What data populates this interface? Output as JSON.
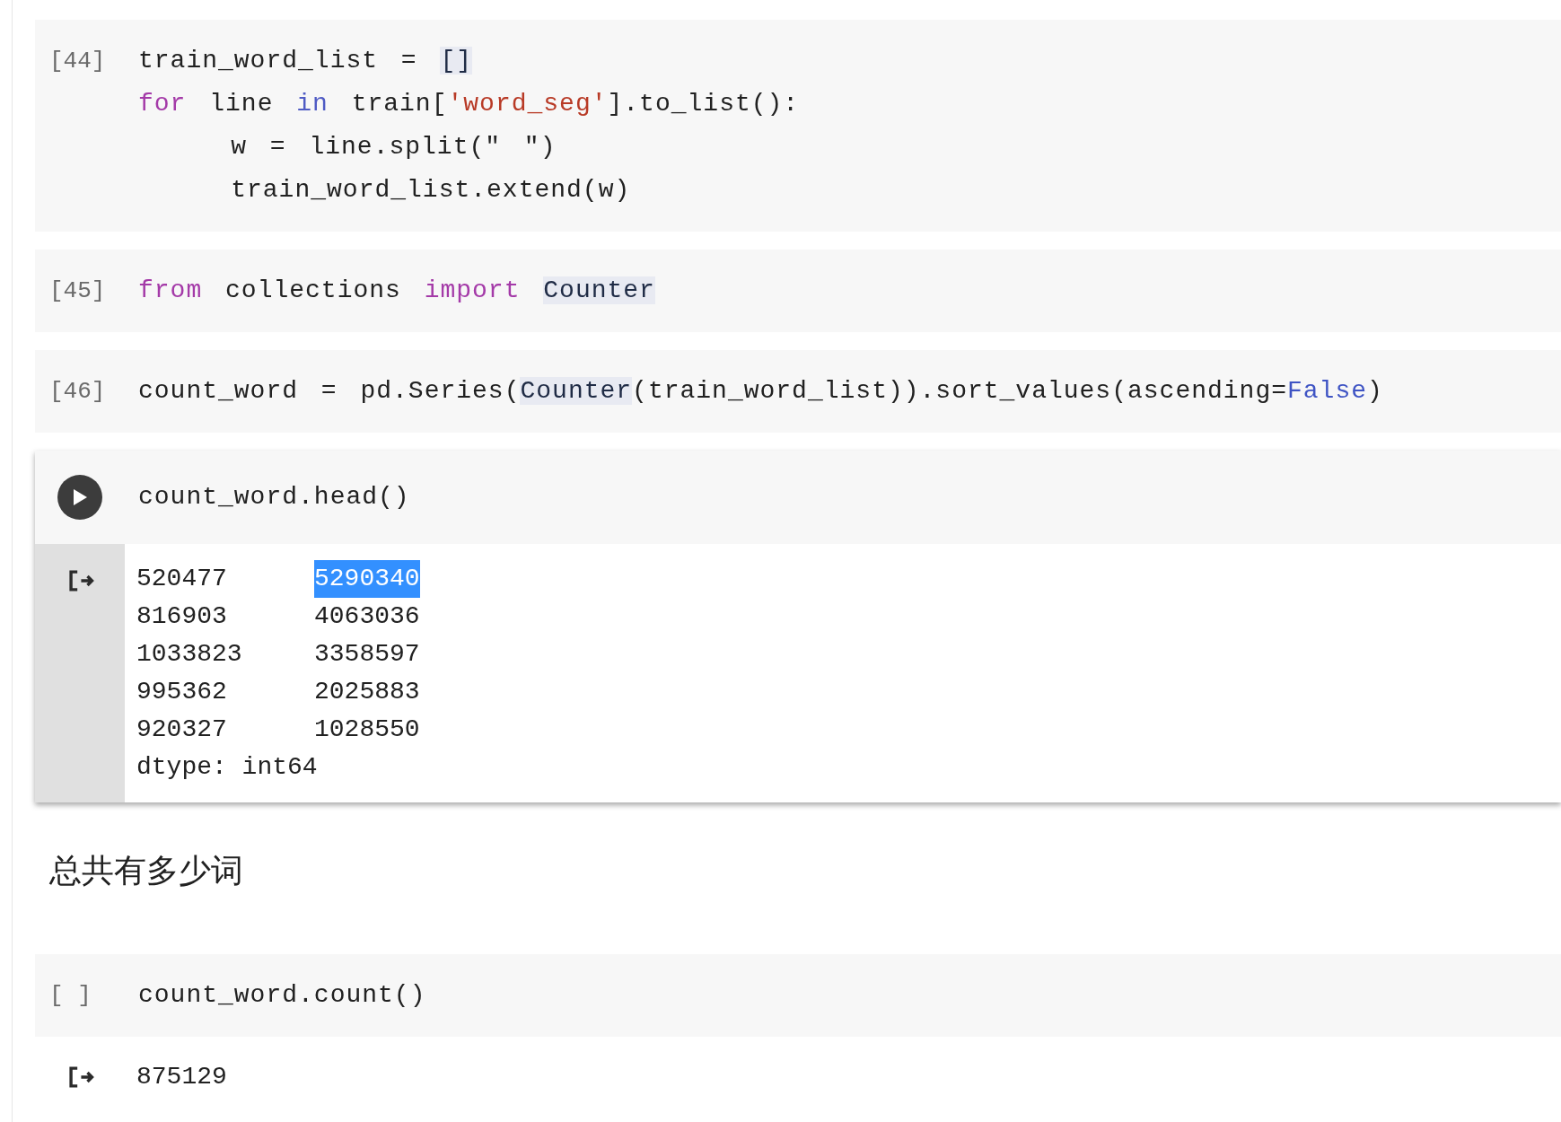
{
  "cells": [
    {
      "kind": "code",
      "focused": false,
      "prompt": {
        "kind": "count",
        "text": "[44]"
      },
      "lines": [
        [
          {
            "kind": "plain",
            "t": "train_word_list = "
          },
          {
            "kind": "match",
            "t": "[]"
          }
        ],
        [
          {
            "kind": "keyword",
            "t": "for"
          },
          {
            "kind": "plain",
            "t": " line "
          },
          {
            "kind": "operator",
            "t": "in"
          },
          {
            "kind": "plain",
            "t": " train["
          },
          {
            "kind": "string",
            "t": "'word_seg'"
          },
          {
            "kind": "plain",
            "t": "].to_list():"
          }
        ],
        [
          {
            "kind": "plain",
            "t": "    w = line.split(\" \")"
          }
        ],
        [
          {
            "kind": "plain",
            "t": "    train_word_list.extend(w)"
          }
        ]
      ]
    },
    {
      "kind": "code",
      "focused": false,
      "prompt": {
        "kind": "count",
        "text": "[45]"
      },
      "lines": [
        [
          {
            "kind": "keyword",
            "t": "from"
          },
          {
            "kind": "plain",
            "t": " collections "
          },
          {
            "kind": "keyword",
            "t": "import "
          },
          {
            "kind": "match",
            "t": "Counter"
          }
        ]
      ]
    },
    {
      "kind": "code",
      "focused": false,
      "prompt": {
        "kind": "count",
        "text": "[46]"
      },
      "lines": [
        [
          {
            "kind": "plain",
            "t": "count_word = pd.Series("
          },
          {
            "kind": "match",
            "t": "Counter"
          },
          {
            "kind": "plain",
            "t": "(train_word_list)).sort_values(ascending="
          },
          {
            "kind": "constant",
            "t": "False"
          },
          {
            "kind": "plain",
            "t": ")"
          }
        ]
      ]
    },
    {
      "kind": "code",
      "focused": true,
      "prompt": {
        "kind": "run"
      },
      "lines": [
        [
          {
            "kind": "plain",
            "t": "count_word.head()"
          }
        ]
      ],
      "output": {
        "rows": [
          {
            "index": "520477",
            "value": "5290340",
            "selected": true
          },
          {
            "index": "816903",
            "value": "4063036",
            "selected": false
          },
          {
            "index": "1033823",
            "value": "3358597",
            "selected": false
          },
          {
            "index": "995362",
            "value": "2025883",
            "selected": false
          },
          {
            "index": "920327",
            "value": "1028550",
            "selected": false
          }
        ],
        "footer": "dtype: int64"
      }
    },
    {
      "kind": "markdown",
      "text": "总共有多少词"
    },
    {
      "kind": "code",
      "focused": false,
      "prompt": {
        "kind": "empty",
        "text": "[ ]"
      },
      "lines": [
        [
          {
            "kind": "plain",
            "t": "count_word.count()"
          }
        ]
      ],
      "output": {
        "text": "875129"
      }
    }
  ]
}
